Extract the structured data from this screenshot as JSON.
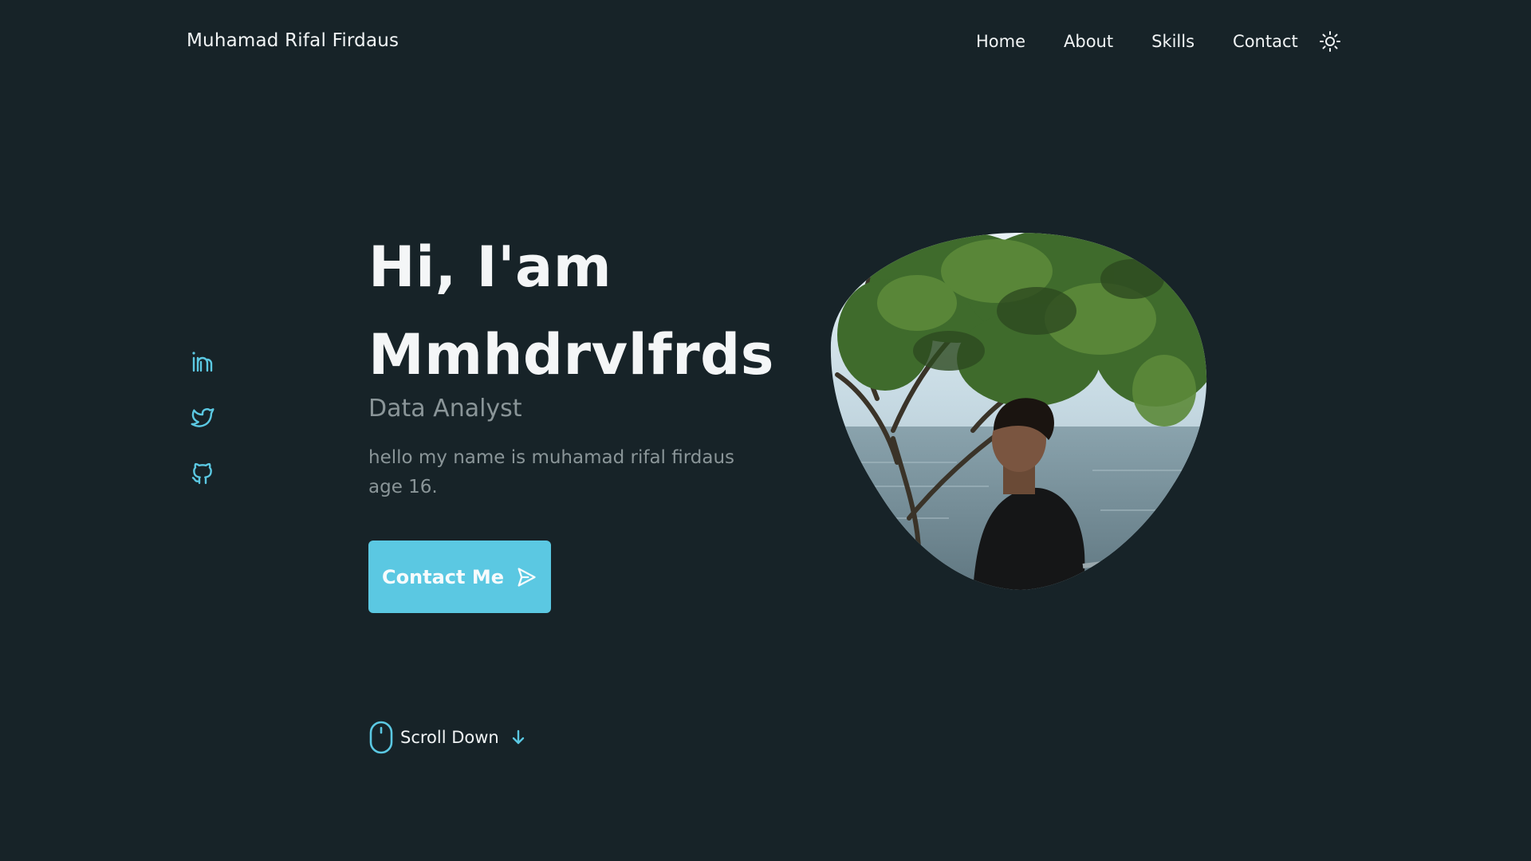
{
  "header": {
    "logo": "Muhamad Rifal Firdaus",
    "nav": [
      "Home",
      "About",
      "Skills",
      "Contact"
    ],
    "theme_icon": "sun-icon"
  },
  "socials": [
    {
      "name": "linkedin",
      "icon": "linkedin-icon"
    },
    {
      "name": "twitter",
      "icon": "twitter-icon"
    },
    {
      "name": "github",
      "icon": "github-icon"
    }
  ],
  "hero": {
    "greeting_line1": "Hi, I'am",
    "greeting_line2": "Mmhdrvlfrds",
    "subtitle": "Data Analyst",
    "description": "hello my name is muhamad rifal firdaus age 16.",
    "button_label": "Contact Me",
    "button_icon": "send-icon",
    "scroll_label": "Scroll Down",
    "scroll_icon": "mouse-icon",
    "scroll_arrow_icon": "arrow-down-icon"
  },
  "colors": {
    "background": "#172328",
    "accent": "#5bc8e2",
    "text": "#f1f4f5",
    "muted": "#8a9598"
  }
}
